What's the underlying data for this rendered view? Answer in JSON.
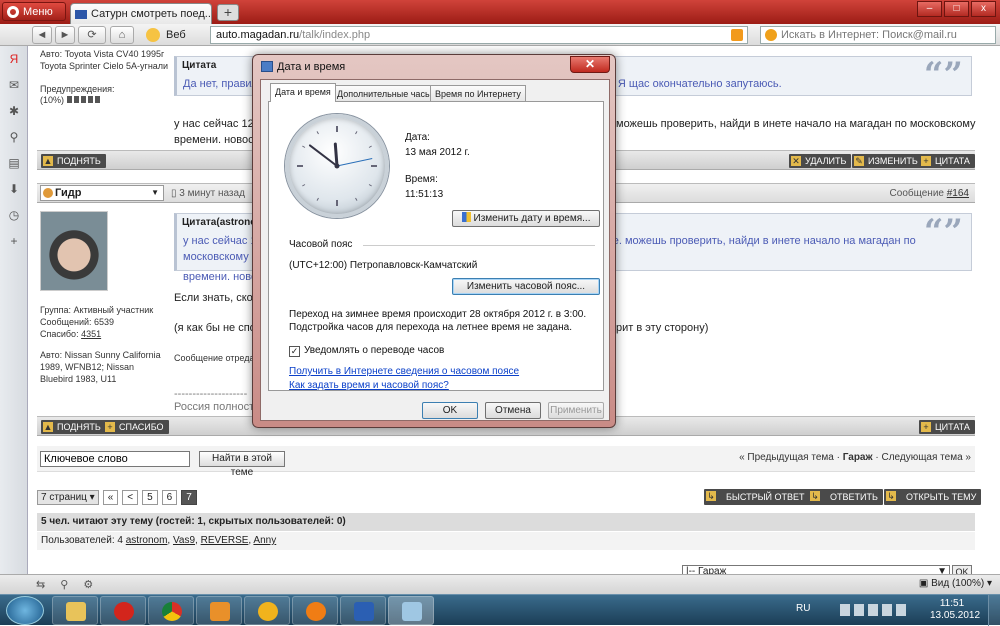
{
  "browser": {
    "menu_label": "Меню",
    "tab_title": "Сатурн смотреть поед...",
    "tab_close": "x",
    "new_tab": "+",
    "window_controls": [
      "–",
      "□",
      "x"
    ],
    "nav_buttons": [
      "◄",
      "►",
      "⟳",
      "⌂"
    ],
    "web_label": "Веб",
    "url_host": "auto.magadan.ru",
    "url_path": "/talk/index.php",
    "search_placeholder": "Искать в Интернет: Поиск@mail.ru"
  },
  "sidebar_icons": [
    "yandex-icon",
    "mail-icon",
    "settings-icon",
    "share-icon",
    "notes-icon",
    "downloads-icon",
    "history-icon",
    "add-panel-icon"
  ],
  "post1": {
    "car": "Авто: Toyota Vista CV40 1995г Toyota Sprinter Cielo 5A-угнали",
    "warnings_label": "Предупреждения:",
    "warnings_value": "(10%)",
    "quote_title": "Цитата",
    "quote_text": "Да нет, правиль",
    "quote_tail": "? Я щас окончательно запутаюсь.",
    "text_a": "у нас сейчас 12 с",
    "text_b": "времени. новосиб",
    "text_tail": "можешь проверить, найди в инете начало на магадан по московскому",
    "btn_up": "ПОДНЯТЬ",
    "btn_delete": "УДАЛИТЬ",
    "btn_edit": "ИЗМЕНИТЬ",
    "btn_quote": "ЦИТАТА"
  },
  "post2": {
    "author": "Гидр",
    "time": "3 минут назад",
    "message_label": "Сообщение",
    "message_number": "#164",
    "group": "Группа: Активный участник",
    "messages": "Сообщений: 6539",
    "thanks_label": "Спасибо:",
    "thanks_value": "4351",
    "car": "Авто: Nissan Sunny California 1989, WFNB12; Nissan Bluebird 1983, U11",
    "quote_title": "Цитата(astronom @",
    "quote_text_a": "у нас сейчас 12",
    "quote_text_b": "времени. новос",
    "quote_tail": "е. можешь проверить, найди в инете начало на магадан по московскому",
    "text_a": "Если знать, скол",
    "text_b": "(я как бы не спор",
    "text_b_tail": "рит в эту сторону)",
    "edited": "Сообщение отредактир",
    "signature_sep": "--------------------",
    "signature": "Россия полность",
    "btn_up": "ПОДНЯТЬ",
    "btn_thanks": "СПАСИБО",
    "btn_quote": "ЦИТАТА"
  },
  "search": {
    "keyword_value": "Ключевое слово",
    "button": "Найти в этой теме",
    "prev": "« Предыдущая тема",
    "sep": " · ",
    "current": "Гараж",
    "next": "Следующая тема »"
  },
  "pagination": {
    "pages_label": "7 страниц",
    "first": "«",
    "prev": "<",
    "items": [
      "5",
      "6",
      "7"
    ]
  },
  "actions": {
    "quick_reply": "БЫСТРЫЙ ОТВЕТ",
    "reply": "ОТВЕТИТЬ",
    "new_topic": "ОТКРЫТЬ ТЕМУ"
  },
  "readers": {
    "summary": "5 чел. читают эту тему (гостей: 1, скрытых пользователей: 0)",
    "users_label": "Пользователей: 4",
    "users": [
      "astronom",
      "Vas9",
      "REVERSE",
      "Anny"
    ]
  },
  "forum_select": {
    "value": "|-- Гараж",
    "go": "OK"
  },
  "statusbar": {
    "zoom": "Вид (100%)"
  },
  "dialog": {
    "title": "Дата и время",
    "tabs": [
      "Дата и время",
      "Дополнительные часы",
      "Время по Интернету"
    ],
    "date_label": "Дата:",
    "date_value": "13 мая 2012 г.",
    "time_label": "Время:",
    "time_value": "11:51:13",
    "change_datetime": "Изменить дату и время...",
    "tz_header": "Часовой пояс",
    "tz_value": "(UTC+12:00) Петропавловск-Камчатский",
    "change_tz": "Изменить часовой пояс...",
    "dst_line1": "Переход на зимнее время происходит 28 октября 2012 г. в 3:00.",
    "dst_line2": "Подстройка часов для перехода на летнее время не задана.",
    "notify_label": "Уведомлять о переводе часов",
    "notify_checked": true,
    "link1": "Получить в Интернете сведения о часовом поясе",
    "link2": "Как задать время и часовой пояс?",
    "ok": "OK",
    "cancel": "Отмена",
    "apply": "Применить",
    "clock": {
      "hours": 11,
      "minutes": 51,
      "seconds": 13
    }
  },
  "taskbar": {
    "apps": [
      "explorer-icon",
      "opera-icon",
      "chrome-icon",
      "media-player-icon",
      "aimp-icon",
      "mail-agent-icon",
      "word-icon",
      "datetime-control-icon"
    ],
    "lang": "RU",
    "time": "11:51",
    "date": "13.05.2012"
  }
}
